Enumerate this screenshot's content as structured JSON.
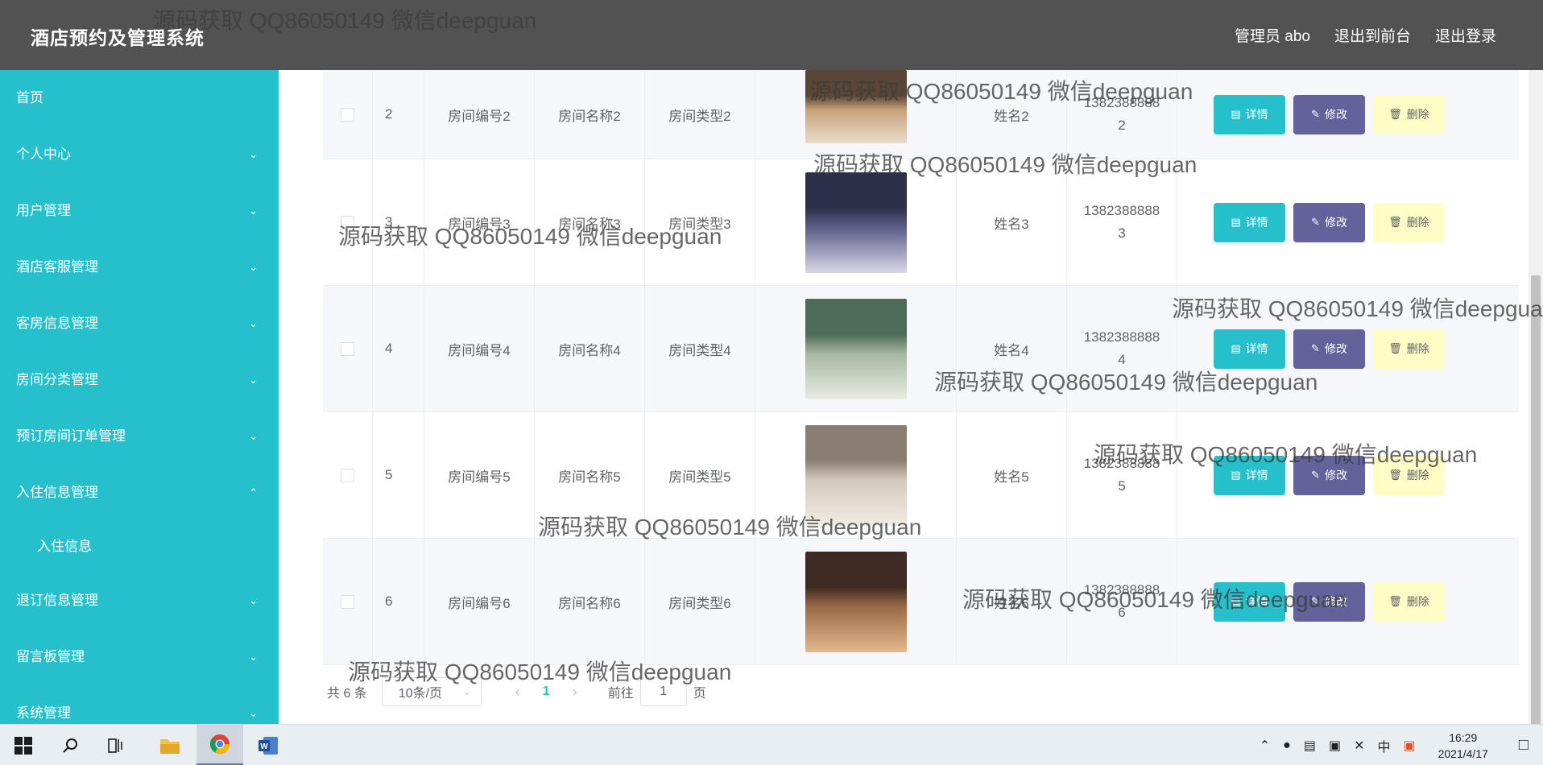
{
  "header": {
    "title": "酒店预约及管理系统",
    "admin": "管理员 abo",
    "to_front": "退出到前台",
    "logout": "退出登录"
  },
  "sidebar": {
    "items": [
      {
        "label": "首页"
      },
      {
        "label": "个人中心",
        "chevron": "chevron-down"
      },
      {
        "label": "用户管理",
        "chevron": "chevron-down"
      },
      {
        "label": "酒店客服管理",
        "chevron": "chevron-down"
      },
      {
        "label": "客房信息管理",
        "chevron": "chevron-down"
      },
      {
        "label": "房间分类管理",
        "chevron": "chevron-down"
      },
      {
        "label": "预订房间订单管理",
        "chevron": "chevron-down"
      },
      {
        "label": "入住信息管理",
        "chevron": "chevron-up"
      },
      {
        "label": "入住信息",
        "sub": true
      },
      {
        "label": "退订信息管理",
        "chevron": "chevron-down"
      },
      {
        "label": "留言板管理",
        "chevron": "chevron-down"
      },
      {
        "label": "系统管理",
        "chevron": "chevron-down"
      }
    ]
  },
  "table": {
    "rows": [
      {
        "index": "2",
        "room_no": "房间编号2",
        "room_name": "房间名称2",
        "room_type": "房间类型2",
        "guest": "姓名2",
        "phone": "1382388888",
        "phone2": "2"
      },
      {
        "index": "3",
        "room_no": "房间编号3",
        "room_name": "房间名称3",
        "room_type": "房间类型3",
        "guest": "姓名3",
        "phone": "1382388888",
        "phone2": "3"
      },
      {
        "index": "4",
        "room_no": "房间编号4",
        "room_name": "房间名称4",
        "room_type": "房间类型4",
        "guest": "姓名4",
        "phone": "1382388888",
        "phone2": "4"
      },
      {
        "index": "5",
        "room_no": "房间编号5",
        "room_name": "房间名称5",
        "room_type": "房间类型5",
        "guest": "姓名5",
        "phone": "1382388888",
        "phone2": "5"
      },
      {
        "index": "6",
        "room_no": "房间编号6",
        "room_name": "房间名称6",
        "room_type": "房间类型6",
        "guest": "姓名6",
        "phone": "1382388888",
        "phone2": "6"
      }
    ],
    "buttons": {
      "detail": "详情",
      "edit": "修改",
      "delete": "删除"
    }
  },
  "pagination": {
    "total": "共 6 条",
    "page_size": "10条/页",
    "current_page": "1",
    "goto_label": "前往",
    "goto_value": "1",
    "page_suffix": "页"
  },
  "watermark": "源码获取 QQ86050149 微信deepguan",
  "taskbar": {
    "time": "16:29",
    "date": "2021/4/17",
    "ime": "中"
  },
  "colors": {
    "sidebar": "#26c0cd",
    "header": "#525252",
    "detail_button": "#26c0cd",
    "edit_button": "#63629a",
    "delete_button": "#fdfdc6"
  }
}
